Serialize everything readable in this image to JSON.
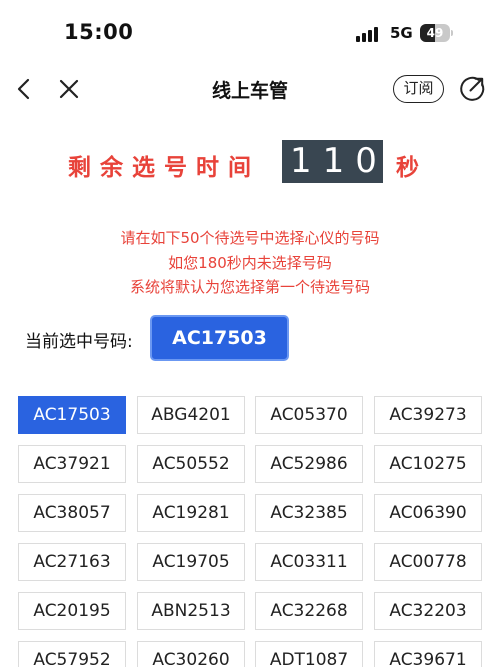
{
  "status_bar": {
    "time": "15:00",
    "network": "5G",
    "battery_level": "49"
  },
  "nav": {
    "back_icon": "chevron-left-icon",
    "close_icon": "close-icon",
    "title": "线上车管",
    "subscribe_label": "订阅",
    "share_icon": "share-icon"
  },
  "countdown": {
    "label": "剩余选号时间",
    "value": "110",
    "unit": "秒"
  },
  "notice": {
    "line1": "请在如下50个待选号中选择心仪的号码",
    "line2": "如您180秒内未选择号码",
    "line3": "系统将默认为您选择第一个待选号码"
  },
  "current": {
    "label": "当前选中号码:",
    "value": "AC17503"
  },
  "plates": [
    "AC17503",
    "ABG4201",
    "AC05370",
    "AC39273",
    "AC37921",
    "AC50552",
    "AC52986",
    "AC10275",
    "AC38057",
    "AC19281",
    "AC32385",
    "AC06390",
    "AC27163",
    "AC19705",
    "AC03311",
    "AC00778",
    "AC20195",
    "ABN2513",
    "AC32268",
    "AC32203",
    "AC57952",
    "AC30260",
    "ADT1087",
    "AC39671"
  ],
  "selected_index": 0,
  "colors": {
    "accent_blue": "#2a63e0",
    "countdown_bg": "#394651",
    "alert_red": "#e8433a"
  }
}
